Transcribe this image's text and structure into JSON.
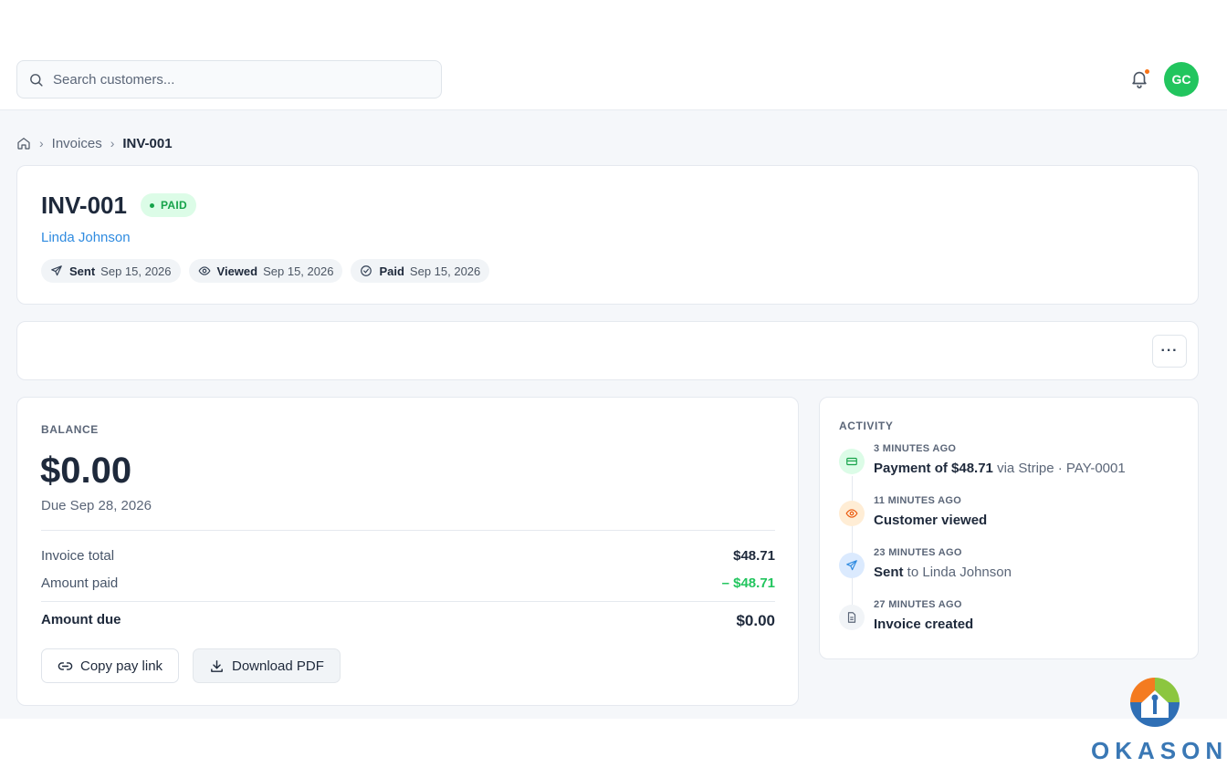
{
  "search": {
    "placeholder": "Search customers..."
  },
  "user": {
    "initials": "GC"
  },
  "breadcrumb": {
    "items": [
      "Invoices",
      "INV-001"
    ]
  },
  "invoice": {
    "number": "INV-001",
    "status": "PAID",
    "customer": "Linda Johnson",
    "events": [
      {
        "label": "Sent",
        "date": "Sep 15, 2026",
        "icon": "send-icon"
      },
      {
        "label": "Viewed",
        "date": "Sep 15, 2026",
        "icon": "eye-icon"
      },
      {
        "label": "Paid",
        "date": "Sep 15, 2026",
        "icon": "check-circle-icon"
      }
    ]
  },
  "toolbar": {
    "more_label": "···"
  },
  "balance": {
    "label": "BALANCE",
    "amount": "$0.00",
    "due": "Due Sep 28, 2026",
    "rows": [
      {
        "label": "Invoice total",
        "value": "$48.71"
      },
      {
        "label": "Amount paid",
        "value": "– $48.71"
      }
    ],
    "total": {
      "label": "Amount due",
      "value": "$0.00"
    },
    "copy_label": "Copy pay link",
    "pdf_label": "Download PDF"
  },
  "activity": {
    "label": "ACTIVITY",
    "items": [
      {
        "time": "3 MINUTES AGO",
        "strong": "Payment of $48.71",
        "rest": " via Stripe · PAY-0001",
        "icon": "credit-card-icon"
      },
      {
        "time": "11 MINUTES AGO",
        "strong": "Customer viewed",
        "rest": "",
        "icon": "eye-icon"
      },
      {
        "time": "23 MINUTES AGO",
        "strong": "Sent",
        "rest": " to Linda Johnson",
        "icon": "send-icon"
      },
      {
        "time": "27 MINUTES AGO",
        "strong": "Invoice created",
        "rest": "",
        "icon": "document-icon"
      }
    ]
  },
  "brand": {
    "name": "OKASON"
  },
  "colors": {
    "accent": "#2f8be0",
    "paid_green": "#22c55e",
    "avatar": "#22c55e",
    "notification_dot": "#f97316",
    "brand_blue": "#3a78b5"
  }
}
